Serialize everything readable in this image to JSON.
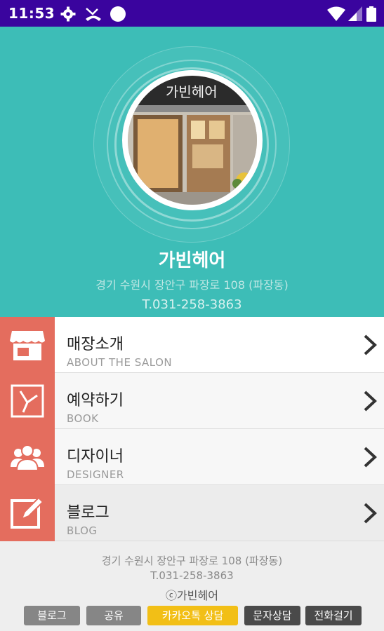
{
  "status_bar": {
    "time": "11:53",
    "icons": [
      "gear-icon",
      "missed-call-icon",
      "circle-icon",
      "wifi-icon",
      "signal-icon",
      "battery-icon"
    ]
  },
  "header": {
    "salon_name": "가빈헤어",
    "address": "경기 수원시 장안구 파장로 108 (파장동)",
    "phone": "T.031-258-3863",
    "photo_sign_text": "가빈헤어"
  },
  "menu": {
    "items": [
      {
        "title": "매장소개",
        "subtitle": "ABOUT THE SALON",
        "icon": "store-icon"
      },
      {
        "title": "예약하기",
        "subtitle": "BOOK",
        "icon": "clock-icon"
      },
      {
        "title": "디자이너",
        "subtitle": "DESIGNER",
        "icon": "people-icon"
      },
      {
        "title": "블로그",
        "subtitle": "BLOG",
        "icon": "edit-icon"
      }
    ]
  },
  "footer": {
    "address": "경기 수원시 장안구 파장로 108 (파장동)",
    "phone": "T.031-258-3863",
    "copyright": "ⓒ가빈헤어",
    "buttons": {
      "blog": "블로그",
      "share": "공유",
      "kakao": "카카오톡 상담",
      "sms": "문자상담",
      "call": "전화걸기"
    }
  },
  "colors": {
    "status_bar": "#3a049e",
    "header": "#3dbdb7",
    "menu_icon_bg": "#e46d5e",
    "kakao_button": "#f2bf16"
  }
}
